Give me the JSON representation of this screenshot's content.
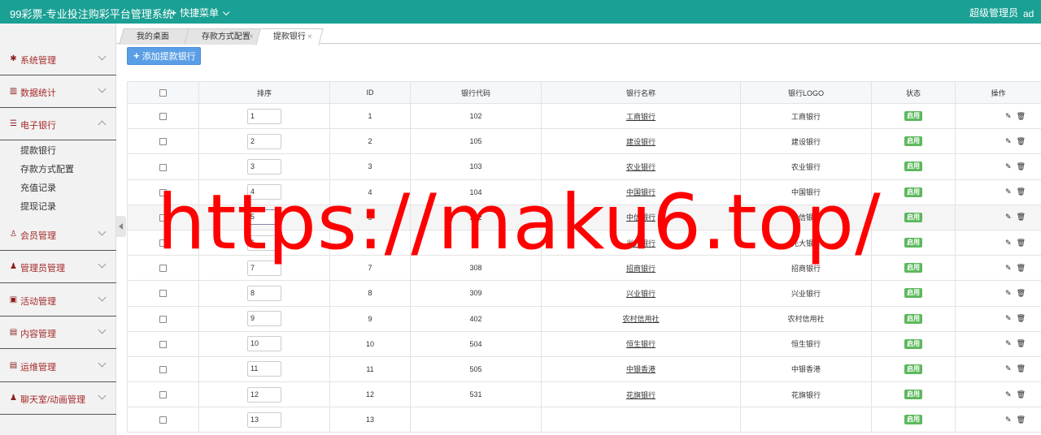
{
  "header": {
    "brand": "99彩票-专业投注购彩平台管理系统",
    "quick_menu": "快捷菜单",
    "admin": "超级管理员",
    "admin_name": "ad"
  },
  "sidebar": {
    "items": [
      {
        "label": "系统管理",
        "icon": "gear-icon",
        "glyph": "✱"
      },
      {
        "label": "数据统计",
        "icon": "chart-icon",
        "glyph": "▥"
      },
      {
        "label": "电子银行",
        "icon": "list-icon",
        "glyph": "☰"
      },
      {
        "label": "会员管理",
        "icon": "user-outline-icon",
        "glyph": "♙"
      },
      {
        "label": "管理员管理",
        "icon": "user-icon",
        "glyph": "♟"
      },
      {
        "label": "活动管理",
        "icon": "gift-icon",
        "glyph": "▣"
      },
      {
        "label": "内容管理",
        "icon": "doc-icon",
        "glyph": "▤"
      },
      {
        "label": "运维管理",
        "icon": "server-icon",
        "glyph": "▤"
      },
      {
        "label": "聊天室/动画管理",
        "icon": "chat-user-icon",
        "glyph": "♟"
      }
    ],
    "sub_items": [
      "提款银行",
      "存款方式配置",
      "充值记录",
      "提现记录"
    ]
  },
  "tabs": [
    {
      "label": "我的桌面"
    },
    {
      "label": "存款方式配置",
      "close": "×"
    },
    {
      "label": "提款银行",
      "close": "×"
    }
  ],
  "toolbar": {
    "add_label": "添加提款银行"
  },
  "table": {
    "headers": [
      "排序",
      "ID",
      "银行代码",
      "银行名称",
      "银行LOGO",
      "状态",
      "操作"
    ],
    "rows": [
      {
        "sort": "1",
        "id": "1",
        "code": "102",
        "name": "工商银行",
        "logo": "工商银行",
        "status": "启用"
      },
      {
        "sort": "2",
        "id": "2",
        "code": "105",
        "name": "建设银行",
        "logo": "建设银行",
        "status": "启用"
      },
      {
        "sort": "3",
        "id": "3",
        "code": "103",
        "name": "农业银行",
        "logo": "农业银行",
        "status": "启用"
      },
      {
        "sort": "4",
        "id": "4",
        "code": "104",
        "name": "中国银行",
        "logo": "中国银行",
        "status": "启用"
      },
      {
        "sort": "5",
        "id": "5",
        "code": "302",
        "name": "中信银行",
        "logo": "中信银行",
        "status": "启用"
      },
      {
        "sort": "6",
        "id": "6",
        "code": "3",
        "name": "光大银行",
        "logo": "光大银行",
        "status": "启用"
      },
      {
        "sort": "7",
        "id": "7",
        "code": "308",
        "name": "招商银行",
        "logo": "招商银行",
        "status": "启用"
      },
      {
        "sort": "8",
        "id": "8",
        "code": "309",
        "name": "兴业银行",
        "logo": "兴业银行",
        "status": "启用"
      },
      {
        "sort": "9",
        "id": "9",
        "code": "402",
        "name": "农村信用社",
        "logo": "农村信用社",
        "status": "启用"
      },
      {
        "sort": "10",
        "id": "10",
        "code": "504",
        "name": "恒生银行",
        "logo": "恒生银行",
        "status": "启用"
      },
      {
        "sort": "11",
        "id": "11",
        "code": "505",
        "name": "中银香港",
        "logo": "中银香港",
        "status": "启用"
      },
      {
        "sort": "12",
        "id": "12",
        "code": "531",
        "name": "花旗银行",
        "logo": "花旗银行",
        "status": "启用"
      },
      {
        "sort": "13",
        "id": "13",
        "code": "",
        "name": "",
        "logo": "",
        "status": "启用"
      }
    ]
  },
  "watermark": "https://maku6.top/"
}
